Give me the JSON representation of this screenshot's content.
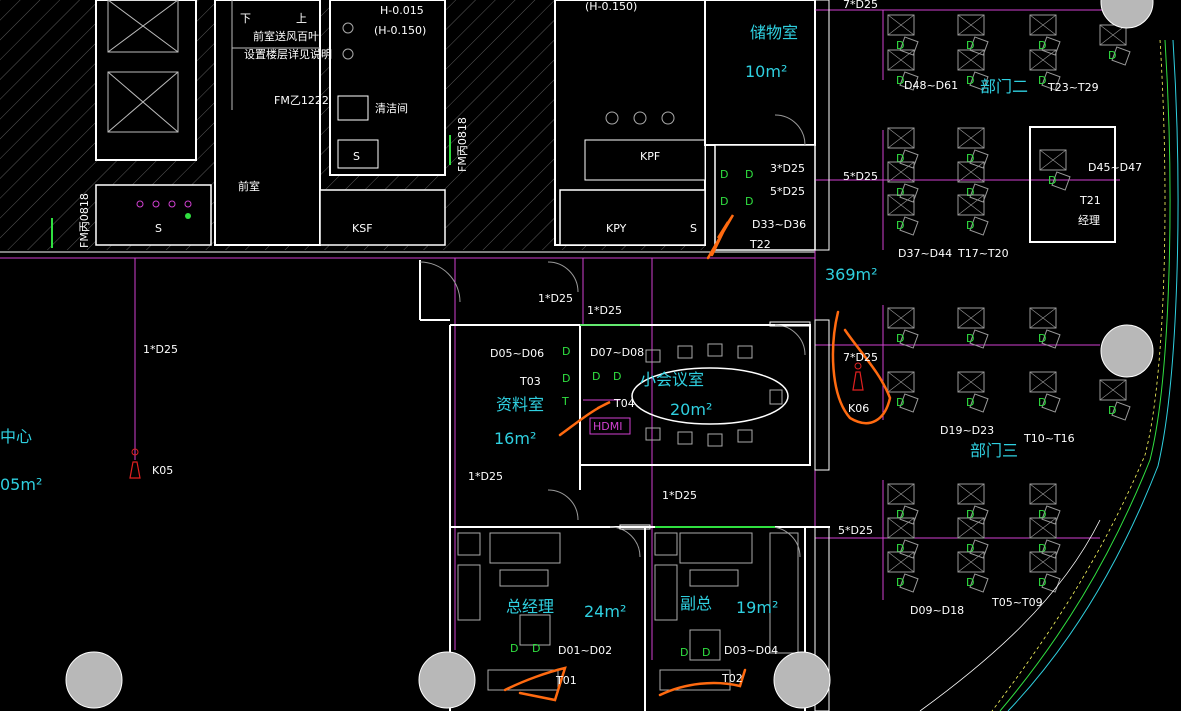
{
  "colors": {
    "background": "#000000",
    "wall": "#ffffff",
    "hatch": "#6a6a6a",
    "pink": "#d040d0",
    "cyan": "#2fd0e0",
    "green": "#30e040",
    "orange": "#ff6a10",
    "red": "#e02020",
    "column": "#b8b8b8"
  },
  "rooms": {
    "storage": {
      "name": "储物室",
      "area": "10m²"
    },
    "meeting": {
      "name": "小会议室",
      "area": "20m²"
    },
    "archive": {
      "name": "资料室",
      "area": "16m²"
    },
    "gm": {
      "name": "总经理",
      "area": "24m²"
    },
    "vp": {
      "name": "副总",
      "area": "19m²"
    },
    "left_center": {
      "name": "中心",
      "area": "05m²"
    },
    "open_area": {
      "area": "369m²"
    },
    "front_room": {
      "name": "前室"
    },
    "cleaning": {
      "name": "清洁间"
    }
  },
  "departments": {
    "dept2": "部门二",
    "dept3": "部门三"
  },
  "workstation_labels": {
    "d48_d61": "D48~D61",
    "t23_t29": "T23~T29",
    "d45_d47": "D45~D47",
    "t21": "T21",
    "manager": "经理",
    "d37_d44": "D37~D44",
    "t17_t20": "T17~T20",
    "d19_d23": "D19~D23",
    "t10_t16": "T10~T16",
    "d09_d18": "D09~D18",
    "t05_t09": "T05~T09",
    "d33_d36": "D33~D36",
    "t22": "T22",
    "d05_d06": "D05~D06",
    "t03": "T03",
    "d07_d08": "D07~D08",
    "t04": "T04",
    "d01_d02": "D01~D02",
    "t01": "T01",
    "d03_d04": "D03~D04",
    "t02": "T02"
  },
  "cable_labels": {
    "top_right": "7*D25",
    "mid_right": "5*D25",
    "right_mid": "7*D25",
    "lower_right": "5*D25",
    "left_drop": "1*D25",
    "corridor_a": "1*D25",
    "corridor_b": "1*D25",
    "archive": "1*D25",
    "center": "1*D25",
    "storage_partial": "3*D25",
    "storage_overlap": "5*D25"
  },
  "device_labels": {
    "k05": "K05",
    "k06": "K06",
    "hdmi": "HDMI"
  },
  "annotations": {
    "elev1": "H-0.015",
    "elev2": "(H-0.150)",
    "elev3": "(H-0.150)",
    "note1": "前室送风百叶",
    "note2": "设置楼层详见说明",
    "door_fm": "FM乙1222",
    "door_fm_vert": "FM丙0818",
    "door_fm_vert2": "FM丙0818",
    "up": "上",
    "down": "下",
    "s": "S",
    "ksf": "KSF",
    "kpy": "KPY",
    "kpf": "KPF"
  }
}
